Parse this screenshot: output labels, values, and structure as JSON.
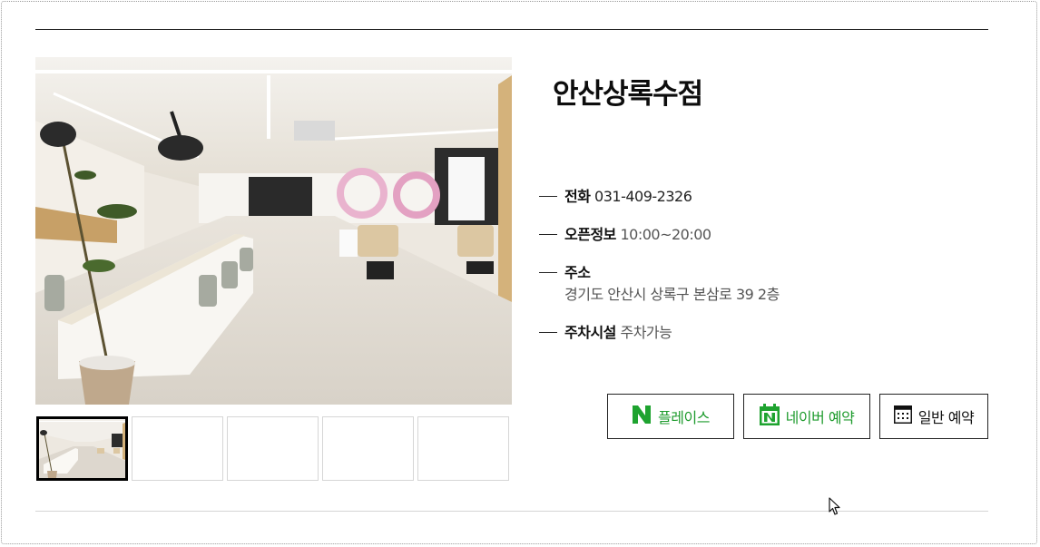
{
  "store": {
    "title": "안산상록수점",
    "phone_label": "전화",
    "phone_value": "031-409-2326",
    "hours_label": "오픈정보",
    "hours_value": "10:00~20:00",
    "address_label": "주소",
    "address_value": "경기도 안산시 상록구 본삼로 39 2층",
    "parking_label": "주차시설",
    "parking_value": "주차가능"
  },
  "gallery": {
    "main_image": "salon-interior-photo",
    "thumbnails": [
      {
        "state": "active",
        "image": "salon-interior-thumb"
      },
      {
        "state": "empty"
      },
      {
        "state": "empty"
      },
      {
        "state": "empty"
      },
      {
        "state": "empty"
      }
    ]
  },
  "buttons": {
    "place_label": "플레이스",
    "naver_reserve_label": "네이버 예약",
    "general_reserve_label": "일반 예약"
  },
  "icons": {
    "place": "naver-n-icon",
    "naver_reserve": "naver-calendar-icon",
    "general_reserve": "calendar-grid-icon"
  },
  "colors": {
    "naver_green": "#1ea32f",
    "text_dark": "#111111",
    "text_muted": "#555555"
  }
}
